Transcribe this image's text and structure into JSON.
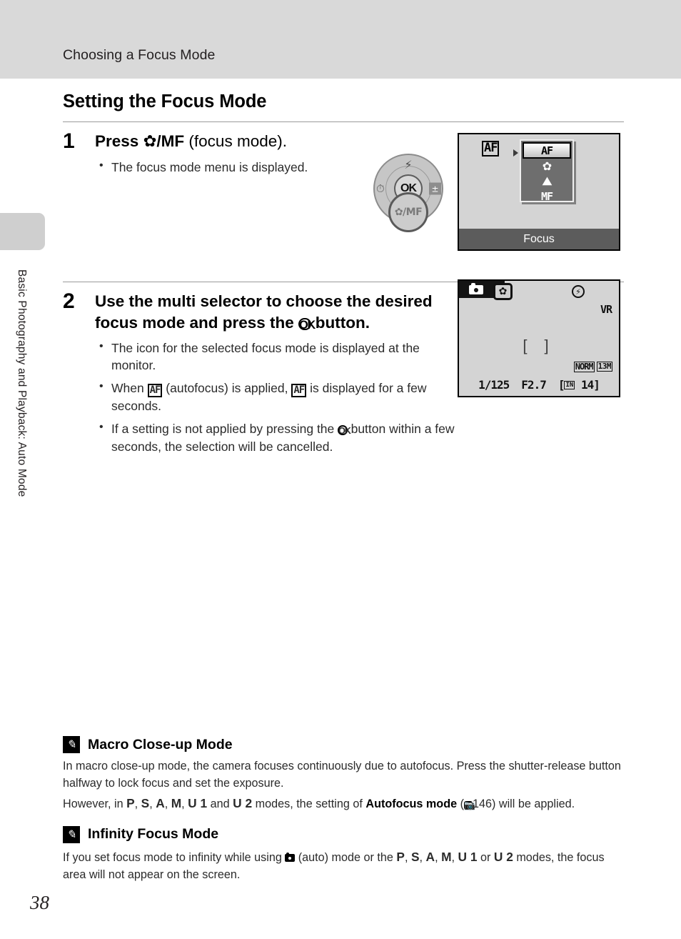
{
  "header": {
    "running_title": "Choosing a Focus Mode"
  },
  "chapter_tab": {
    "label": "Basic Photography and Playback: Auto Mode"
  },
  "page": {
    "number": "38"
  },
  "section": {
    "title": "Setting the Focus Mode"
  },
  "steps": [
    {
      "number": "1",
      "heading_pre": "Press ",
      "heading_sym_flower": "✿",
      "heading_mid": "/MF",
      "heading_post": " (focus mode).",
      "bullets": [
        "The focus mode menu is displayed."
      ]
    },
    {
      "number": "2",
      "heading_a": "Use the multi selector to choose the desired focus mode and press the ",
      "heading_ok": "OK",
      "heading_b": " button.",
      "bullets": [
        {
          "a": "The icon for the selected focus mode is displayed at the monitor.",
          "b": "",
          "c": ""
        },
        {
          "a": "When ",
          "sym1": "AF",
          "b": " (autofocus) is applied, ",
          "sym2": "AF",
          "c": " is displayed for a few seconds."
        },
        {
          "a": "If a setting is not applied by pressing the ",
          "ok": "OK",
          "b": " button within a few seconds, the selection will be cancelled.",
          "c": ""
        }
      ]
    }
  ],
  "dial": {
    "ok_label": "OK",
    "up_icon": "flash-icon",
    "up_glyph": "⚡",
    "left_icon": "self-timer-icon",
    "left_glyph": "⏱",
    "right_icon": "exposure-compensation-icon",
    "right_glyph": "±",
    "down_label": "✿/MF"
  },
  "figure_menu": {
    "callout_label": "AF",
    "items": [
      {
        "label": "AF",
        "icon": "af-text-icon",
        "selected": true
      },
      {
        "label": "✿",
        "icon": "macro-flower-icon",
        "selected": false
      },
      {
        "label": "⛰",
        "icon": "infinity-mountain-icon",
        "selected": false
      },
      {
        "label": "MF",
        "icon": "manual-focus-icon",
        "selected": false
      }
    ],
    "footer_label": "Focus"
  },
  "figure_lcd": {
    "mode_icon": "camera-auto-mode-icon",
    "macro_icon": "macro-flower-icon",
    "flash_icon": "flash-off-icon",
    "flash_glyph": "⚡",
    "vr_label": "VR",
    "focus_area": "[  ]",
    "quality_label": "NORM",
    "image_size_label": "13M",
    "shutter_speed": "1/125",
    "aperture": "F2.7",
    "frames_prefix": "IN",
    "frames_remaining": "14"
  },
  "notes": [
    {
      "icon": "pencil-note-icon",
      "title": "Macro Close-up Mode",
      "paragraphs": [
        "In macro close-up mode, the camera focuses continuously due to autofocus. Press the shutter-release button halfway to lock focus and set the exposure.",
        "However, in P, S, A, M, U 1 and U 2 modes, the setting of Autofocus mode (146) will be applied."
      ],
      "p2": {
        "a": "However, in ",
        "modes": [
          "P",
          "S",
          "A",
          "M",
          "U 1"
        ],
        "b": " and ",
        "mode_last": "U 2",
        "c": " modes, the setting of ",
        "bold": "Autofocus mode",
        "d": " (",
        "ref": "146",
        "e": ") will be applied."
      }
    },
    {
      "icon": "pencil-note-icon",
      "title": "Infinity Focus Mode",
      "p1": {
        "a": "If you set focus mode to infinity while using ",
        "cam": "camera-auto-icon",
        "b": " (auto) mode or the ",
        "modes": [
          "P",
          "S",
          "A",
          "M",
          "U 1"
        ],
        "c": " or ",
        "mode_last": "U 2",
        "d": " modes, the focus area will not appear on the screen."
      }
    }
  ],
  "colors": {
    "header_band": "#d9d9d9",
    "chapter_tab": "#cfcfcf",
    "lcd_background": "#d4d4d4",
    "menu_panel": "#6e6e6e",
    "menu_footer": "#5c5c5c"
  }
}
